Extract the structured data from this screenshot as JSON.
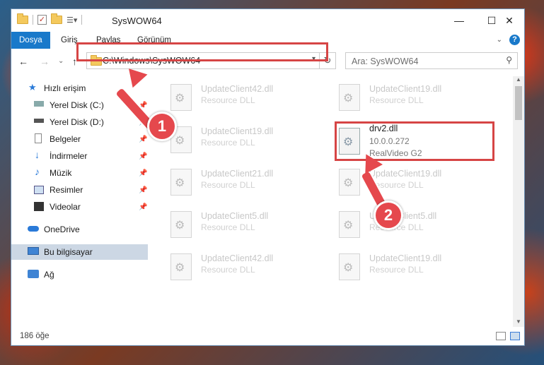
{
  "window": {
    "title": "SysWOW64",
    "controls": {
      "minimize": "—",
      "maximize": "☐",
      "close": "✕"
    }
  },
  "ribbon": {
    "tabs": [
      "Dosya",
      "Giriş",
      "Paylaş",
      "Görünüm"
    ],
    "active_tab": "Dosya"
  },
  "navigation": {
    "back": "←",
    "forward": "→",
    "recent": "⌄",
    "up": "↑",
    "address": "C:\\Windows\\SysWOW64",
    "search_placeholder": "Ara: SysWOW64"
  },
  "sidebar": {
    "items": [
      {
        "label": "Hızlı erişim",
        "icon": "star-icon"
      },
      {
        "label": "Yerel Disk (C:)",
        "icon": "drive-icon",
        "pinned": true
      },
      {
        "label": "Yerel Disk (D:)",
        "icon": "drive-icon",
        "pinned": true
      },
      {
        "label": "Belgeler",
        "icon": "document-icon",
        "pinned": true
      },
      {
        "label": "İndirmeler",
        "icon": "download-icon",
        "pinned": true
      },
      {
        "label": "Müzik",
        "icon": "music-icon",
        "pinned": true
      },
      {
        "label": "Resimler",
        "icon": "image-icon",
        "pinned": true
      },
      {
        "label": "Videolar",
        "icon": "video-icon",
        "pinned": true
      },
      {
        "label": "OneDrive",
        "icon": "cloud-icon"
      },
      {
        "label": "Bu bilgisayar",
        "icon": "computer-icon",
        "selected": true
      },
      {
        "label": "Ağ",
        "icon": "network-icon"
      }
    ]
  },
  "files": [
    {
      "name": "UpdateClient42.dll",
      "desc": "Resource DLL"
    },
    {
      "name": "UpdateClient19.dll",
      "desc": "Resource DLL"
    },
    {
      "name": "UpdateClient19.dll",
      "desc": "Resource DLL"
    },
    {
      "name": "drv2.dll",
      "version": "10.0.0.272",
      "desc": "RealVideo G2"
    },
    {
      "name": "UpdateClient21.dll",
      "desc": "Resource DLL"
    },
    {
      "name": "UpdateClient19.dll",
      "desc": "Resource DLL"
    },
    {
      "name": "UpdateClient5.dll",
      "desc": "Resource DLL"
    },
    {
      "name": "UpdateClient5.dll",
      "desc": "Resource DLL"
    },
    {
      "name": "UpdateClient42.dll",
      "desc": "Resource DLL"
    },
    {
      "name": "UpdateClient19.dll",
      "desc": "Resource DLL"
    }
  ],
  "status": {
    "count": "186 öğe"
  },
  "annotations": {
    "step1": "1",
    "step2": "2"
  },
  "colors": {
    "accent": "#1979ca",
    "highlight": "#d64545",
    "arrow": "#e5484d"
  }
}
